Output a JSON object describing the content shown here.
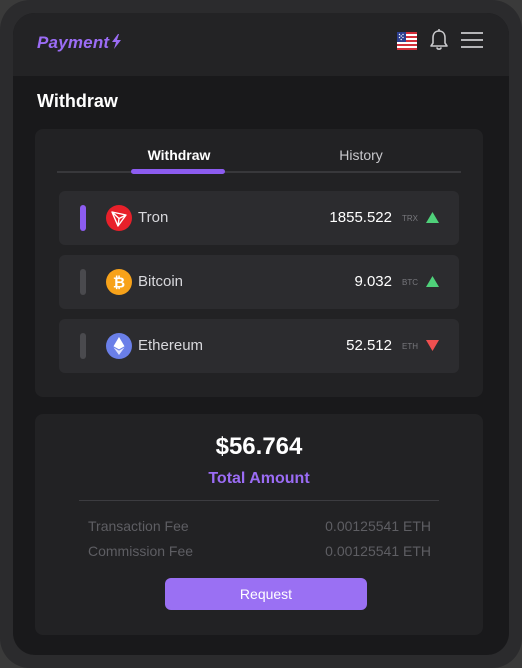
{
  "header": {
    "logo_text": "Payment",
    "icons": [
      "us-flag-icon",
      "bell-icon",
      "menu-icon"
    ]
  },
  "page": {
    "title": "Withdraw"
  },
  "tabs": [
    {
      "label": "Withdraw",
      "active": true
    },
    {
      "label": "History",
      "active": false
    }
  ],
  "coins": [
    {
      "name": "Tron",
      "amount": "1855.522",
      "symbol": "TRX",
      "trend": "up",
      "icon": "tron-icon",
      "selected": true
    },
    {
      "name": "Bitcoin",
      "amount": "9.032",
      "symbol": "BTC",
      "trend": "up",
      "icon": "bitcoin-icon",
      "selected": false
    },
    {
      "name": "Ethereum",
      "amount": "52.512",
      "symbol": "ETH",
      "trend": "down",
      "icon": "ethereum-icon",
      "selected": false
    }
  ],
  "summary": {
    "total_amount": "$56.764",
    "total_label": "Total Amount",
    "fees": [
      {
        "label": "Transaction Fee",
        "value": "0.00125541 ETH"
      },
      {
        "label": "Commission Fee",
        "value": "0.00125541 ETH"
      }
    ],
    "request_label": "Request"
  },
  "colors": {
    "accent": "#8c5cf0",
    "trend_up": "#4fd17a",
    "trend_down": "#f05050",
    "tron": "#e8202a",
    "bitcoin": "#f7a21a",
    "ethereum": "#6a7fe8"
  }
}
